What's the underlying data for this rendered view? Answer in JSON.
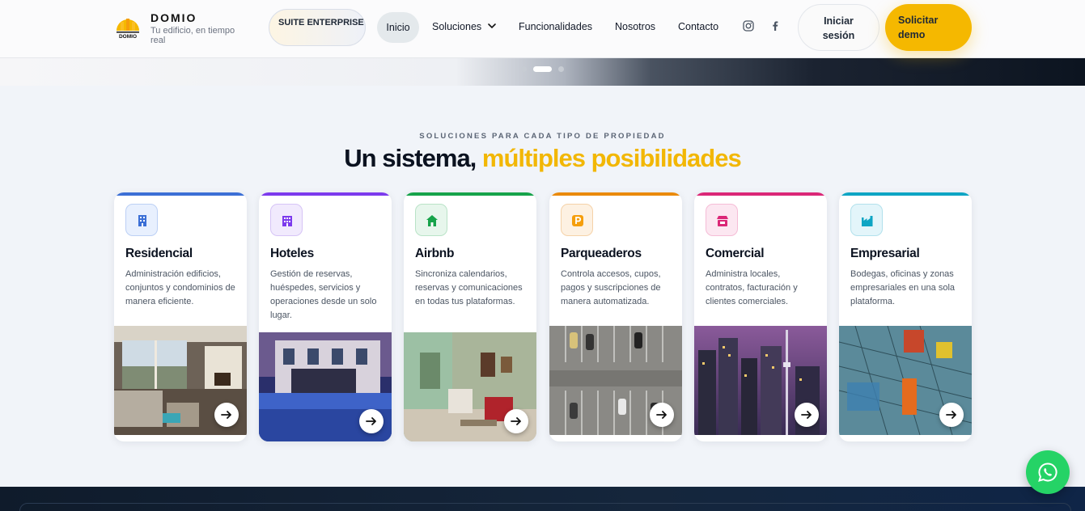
{
  "header": {
    "brand_name": "DOMIO",
    "brand_tagline": "Tu edificio, en tiempo real",
    "suite_badge": "SUITE ENTERPRISE",
    "nav": {
      "inicio": "Inicio",
      "soluciones": "Soluciones",
      "funcionalidades": "Funcionalidades",
      "nosotros": "Nosotros",
      "contacto": "Contacto"
    },
    "login_label": "Iniciar sesión",
    "demo_label": "Solicitar demo",
    "accent_color": "#f5b800"
  },
  "carousel": {
    "slides": 3,
    "active_index": 1
  },
  "section": {
    "kicker": "SOLUCIONES PARA CADA TIPO DE PROPIEDAD",
    "headline_main": "Un sistema,",
    "headline_highlight": "múltiples posibilidades"
  },
  "cards": [
    {
      "title": "Residencial",
      "description": "Administración edificios, conjuntos y condominios de manera eficiente.",
      "icon": "building-icon",
      "accent": "#3b6fd6"
    },
    {
      "title": "Hoteles",
      "description": "Gestión de reservas, huéspedes, servicios y operaciones desde un solo lugar.",
      "icon": "hotel-icon",
      "accent": "#7c3aed"
    },
    {
      "title": "Airbnb",
      "description": "Sincroniza calendarios, reservas y comunicaciones en todas tus plataformas.",
      "icon": "home-icon",
      "accent": "#16a34a"
    },
    {
      "title": "Parqueaderos",
      "description": "Controla accesos, cupos, pagos y suscripciones de manera automatizada.",
      "icon": "parking-icon",
      "accent": "#ea8a0c"
    },
    {
      "title": "Comercial",
      "description": "Administra locales, contratos, facturación y clientes comerciales.",
      "icon": "store-icon",
      "accent": "#db2777"
    },
    {
      "title": "Empresarial",
      "description": "Bodegas, oficinas y zonas empresariales en una sola plataforma.",
      "icon": "factory-icon",
      "accent": "#0ea5c4"
    }
  ]
}
